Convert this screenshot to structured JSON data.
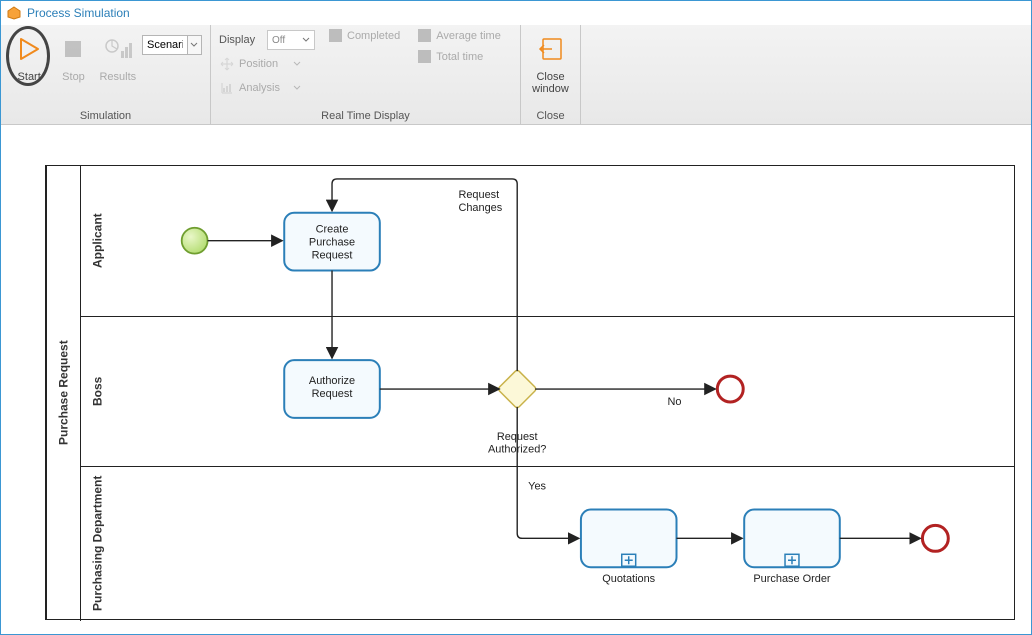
{
  "window": {
    "title": "Process Simulation"
  },
  "ribbon": {
    "simulation": {
      "label": "Simulation",
      "start": "Start",
      "stop": "Stop",
      "results": "Results",
      "scenario_value": "Scenari"
    },
    "realtime": {
      "label": "Real Time Display",
      "display": "Display",
      "display_value": "Off",
      "position": "Position",
      "analysis": "Analysis",
      "completed": "Completed",
      "average_time": "Average time",
      "total_time": "Total time"
    },
    "close": {
      "label": "Close",
      "close_window": "Close window"
    }
  },
  "diagram": {
    "pool": "Purchase Request",
    "lanes": {
      "l1": "Applicant",
      "l2": "Boss",
      "l3": "Purchasing Department"
    },
    "tasks": {
      "create": "Create Purchase Request",
      "authorize": "Authorize Request",
      "quotations": "Quotations",
      "po": "Purchase Order"
    },
    "gateway": "Request Authorized?",
    "flows": {
      "request_changes": "Request Changes",
      "no": "No",
      "yes": "Yes"
    }
  }
}
